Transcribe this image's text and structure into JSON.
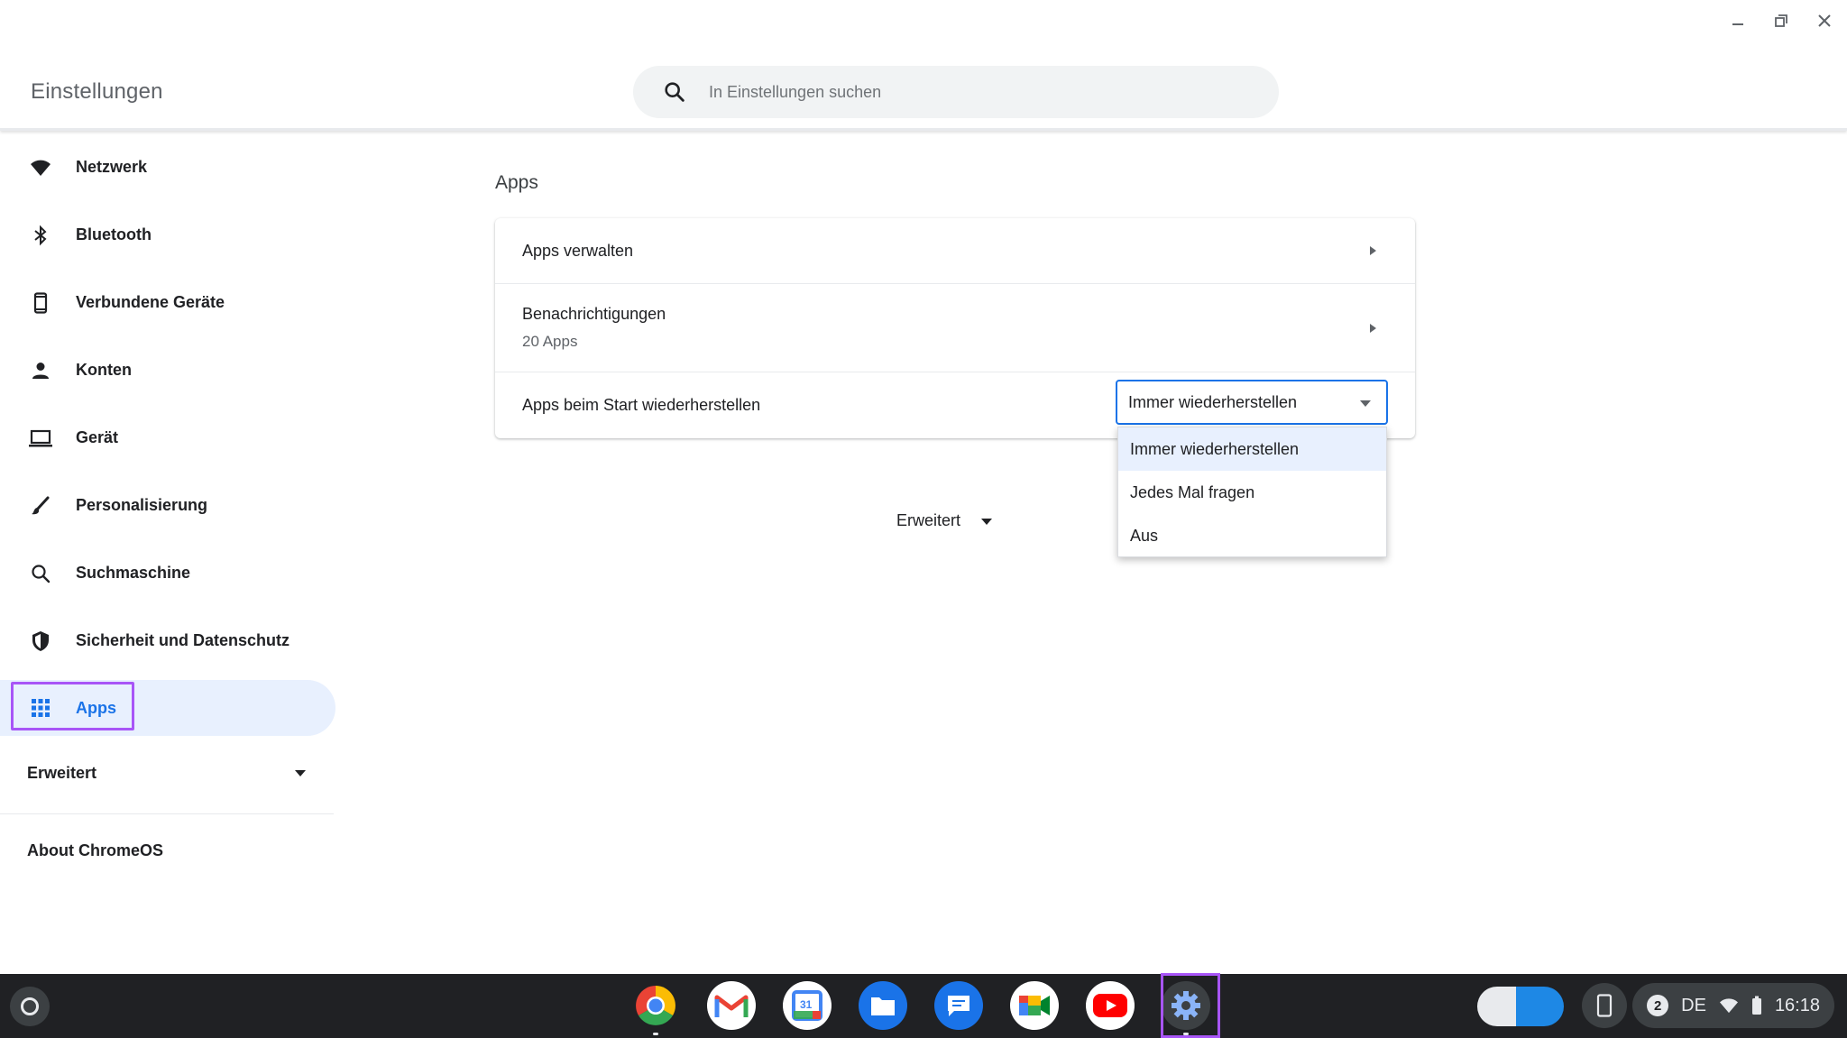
{
  "window": {
    "title": "Einstellungen"
  },
  "search": {
    "placeholder": "In Einstellungen suchen"
  },
  "sidebar": {
    "items": [
      {
        "label": "Netzwerk",
        "icon": "wifi-icon"
      },
      {
        "label": "Bluetooth",
        "icon": "bluetooth-icon"
      },
      {
        "label": "Verbundene Geräte",
        "icon": "phone-icon"
      },
      {
        "label": "Konten",
        "icon": "person-icon"
      },
      {
        "label": "Gerät",
        "icon": "laptop-icon"
      },
      {
        "label": "Personalisierung",
        "icon": "brush-icon"
      },
      {
        "label": "Suchmaschine",
        "icon": "search-icon"
      },
      {
        "label": "Sicherheit und Datenschutz",
        "icon": "shield-icon"
      },
      {
        "label": "Apps",
        "icon": "apps-grid-icon",
        "active": true
      }
    ],
    "advanced_label": "Erweitert",
    "about_label": "About ChromeOS"
  },
  "main": {
    "section_title": "Apps",
    "rows": {
      "manage_apps": "Apps verwalten",
      "notifications": "Benachrichtigungen",
      "notifications_sub": "20 Apps",
      "restore_on_start": "Apps beim Start wiederherstellen"
    },
    "restore_select": {
      "selected": "Immer wiederherstellen",
      "options": [
        "Immer wiederherstellen",
        "Jedes Mal fragen",
        "Aus"
      ]
    },
    "advanced_label": "Erweitert"
  },
  "shelf": {
    "apps": [
      "chrome-icon",
      "gmail-icon",
      "calendar-icon",
      "files-icon",
      "messages-icon",
      "meet-icon",
      "youtube-icon",
      "settings-icon"
    ],
    "tray": {
      "notification_count": "2",
      "keyboard_layout": "DE",
      "time": "16:18"
    }
  },
  "colors": {
    "accent": "#1a73e8",
    "highlight_box": "#a855f7",
    "active_bg": "#e8f0fe",
    "shelf_bg": "#202124"
  }
}
